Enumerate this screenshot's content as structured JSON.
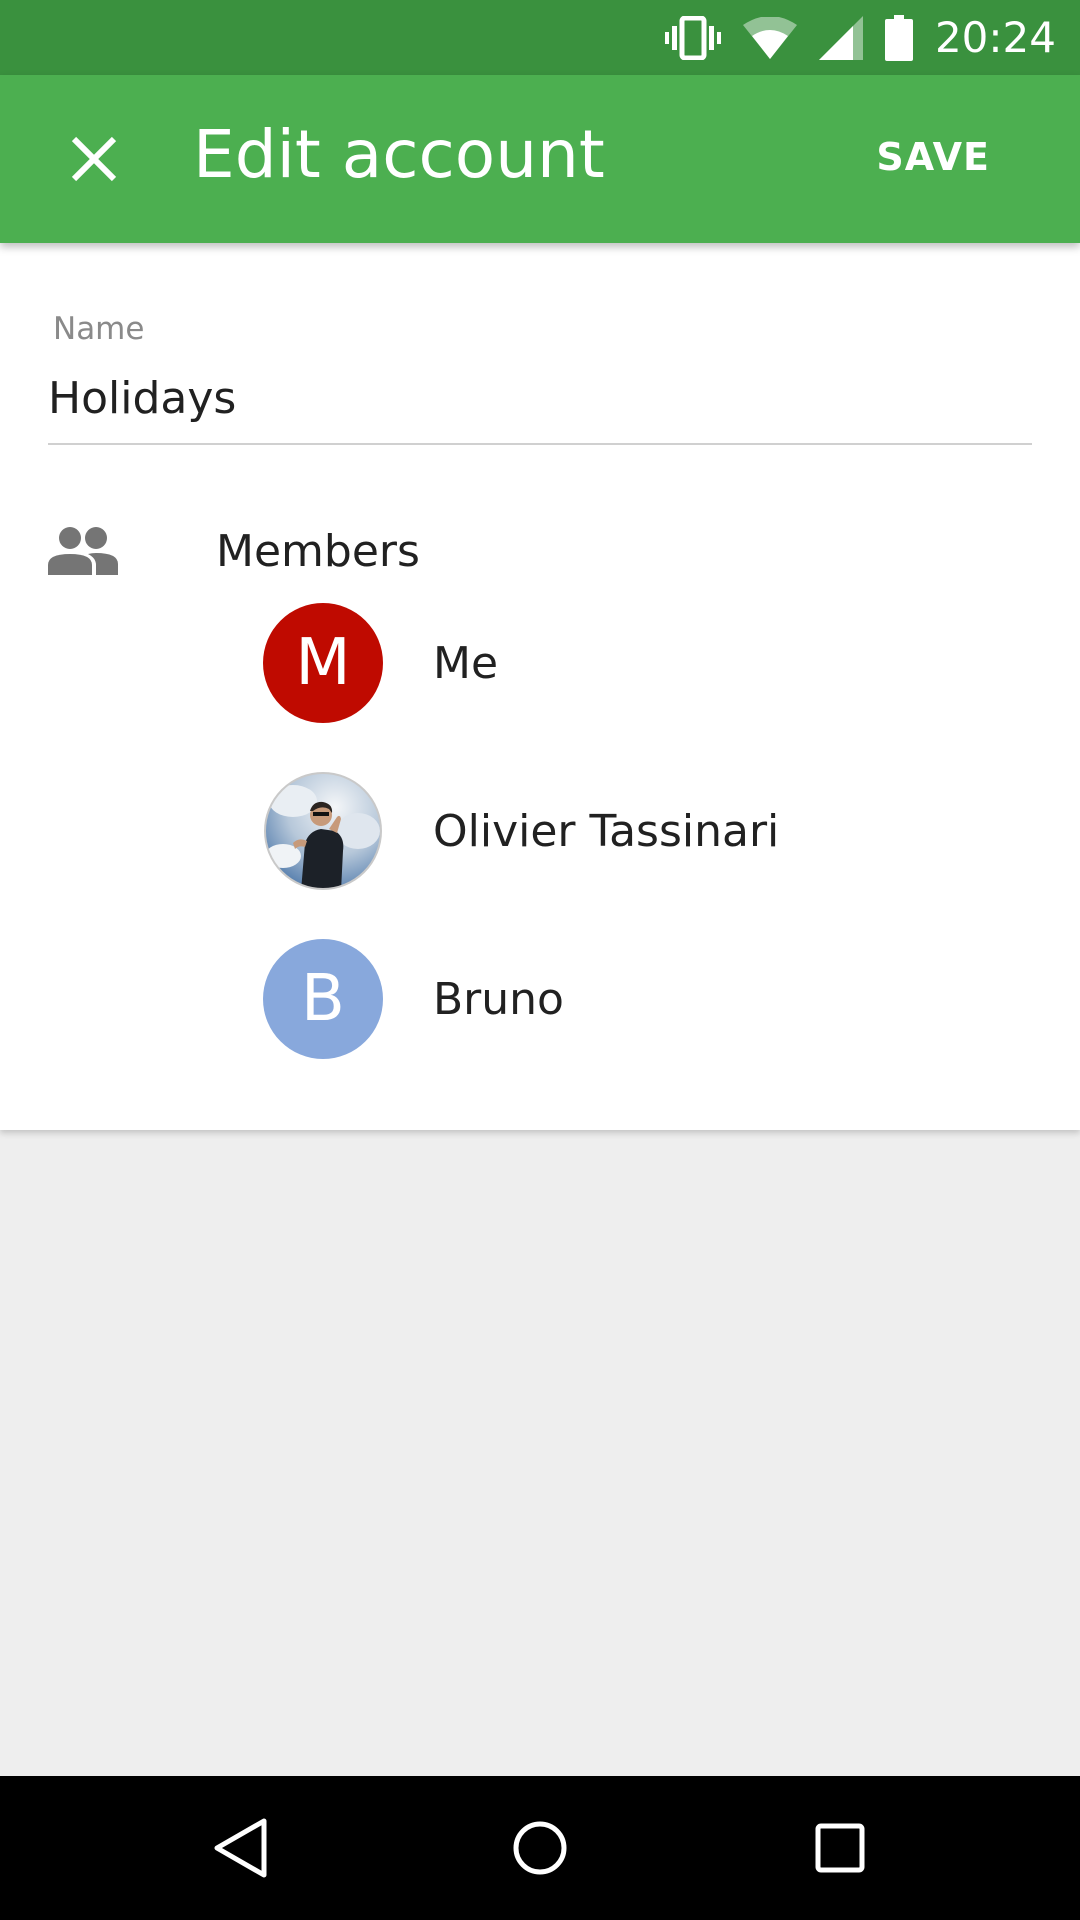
{
  "status_bar": {
    "time": "20:24",
    "icons": [
      "vibrate-icon",
      "wifi-icon",
      "cell-signal-icon",
      "battery-icon"
    ]
  },
  "app_bar": {
    "title": "Edit account",
    "close_icon": "close-icon",
    "save_label": "SAVE",
    "color": "#4caf50",
    "status_color": "#3a913e"
  },
  "form": {
    "name_label": "Name",
    "name_value": "Holidays"
  },
  "members": {
    "title": "Members",
    "icon": "people-icon",
    "items": [
      {
        "name": "Me",
        "initial": "M",
        "avatar_color": "#bf0a00",
        "type": "letter"
      },
      {
        "name": "Olivier Tassinari",
        "initial": "",
        "avatar_color": "#5b86b8",
        "type": "photo"
      },
      {
        "name": "Bruno",
        "initial": "B",
        "avatar_color": "#88a8dc",
        "type": "letter"
      }
    ]
  },
  "nav_bar": {
    "buttons": [
      "back-icon",
      "home-icon",
      "recents-icon"
    ]
  }
}
